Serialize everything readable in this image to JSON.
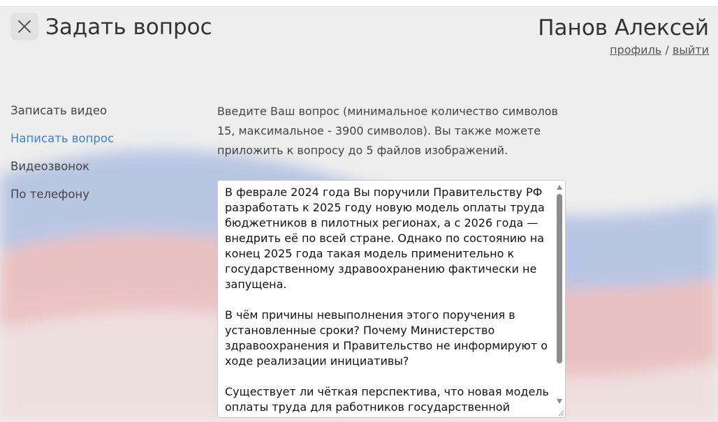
{
  "header": {
    "title": "Задать вопрос",
    "close_icon": "close-icon"
  },
  "user": {
    "name": "Панов Алексей",
    "profile_link": "профиль",
    "separator": "/",
    "logout_link": "выйти"
  },
  "nav": {
    "items": [
      {
        "label": "Записать видео",
        "active": false
      },
      {
        "label": "Написать вопрос",
        "active": true
      },
      {
        "label": "Видеозвонок",
        "active": false
      },
      {
        "label": "По телефону",
        "active": false
      }
    ]
  },
  "form": {
    "instructions": "Введите Ваш вопрос (минимальное количество символов 15, максимальное - 3900 символов). Вы также можете приложить к вопросу до 5 файлов изображений.",
    "question_text": "В феврале 2024 года Вы поручили Правительству РФ разработать к 2025 году новую модель оплаты труда бюджетников в пилотных регионах, а с 2026 года — внедрить её по всей стране. Однако по состоянию на конец 2025 года такая модель применительно к государственному здравоохранению фактически не запущена.\n\nВ чём причины невыполнения этого поручения в установленные сроки? Почему Министерство здравоохранения и Правительство не информируют о ходе реализации инициативы?\n\nСуществует ли чёткая перспектива, что новая модель оплаты труда для работников государственной"
  },
  "colors": {
    "accent": "#3d7fd9",
    "background": "#eeeeee",
    "flag_blue": "#8fa6d6",
    "flag_red": "#e3a3a3"
  }
}
